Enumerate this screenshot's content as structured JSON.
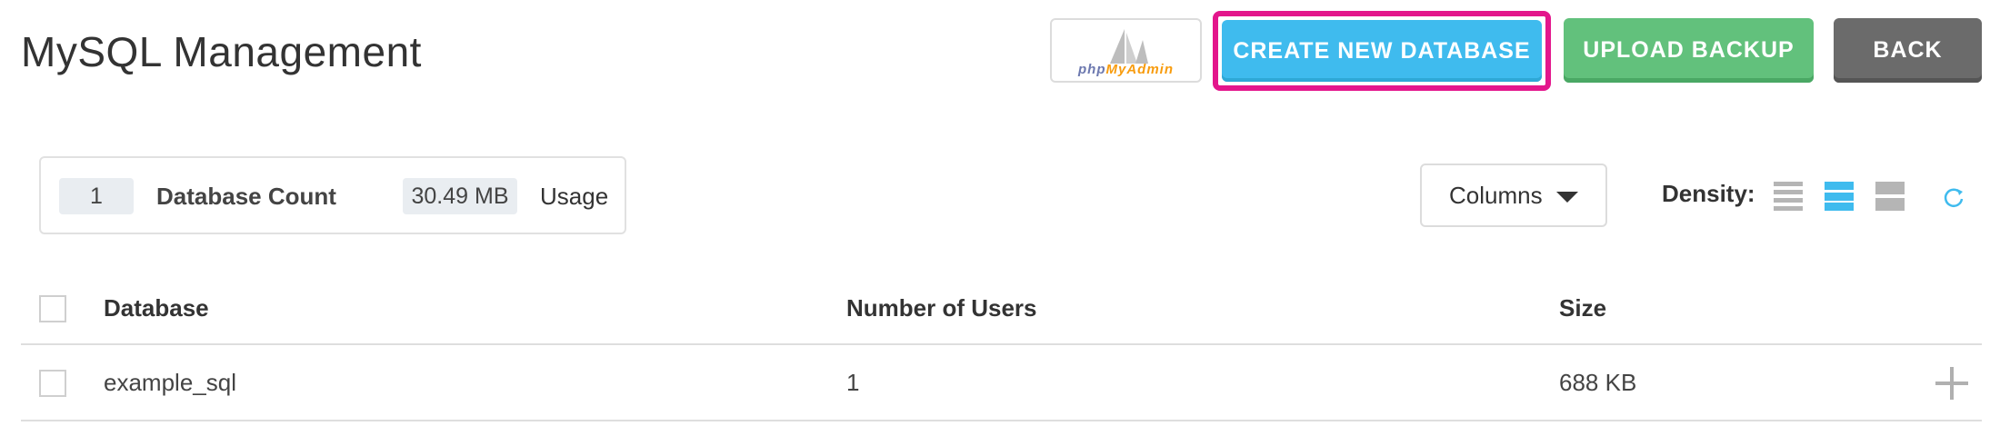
{
  "header": {
    "title": "MySQL Management",
    "phpmyadmin": {
      "php": "php",
      "myadmin": "MyAdmin"
    },
    "create_label": "CREATE NEW DATABASE",
    "upload_label": "UPLOAD BACKUP",
    "back_label": "BACK"
  },
  "stats": {
    "database_count": "1",
    "database_count_label": "Database Count",
    "usage_value": "30.49 MB",
    "usage_label": "Usage"
  },
  "controls": {
    "columns_label": "Columns",
    "density_label": "Density:",
    "density_selected": "normal"
  },
  "table": {
    "columns": [
      "Database",
      "Number of Users",
      "Size"
    ],
    "rows": [
      {
        "database": "example_sql",
        "users": "1",
        "size": "688 KB"
      }
    ]
  },
  "colors": {
    "create": "#3fbbee",
    "upload": "#62c17c",
    "back": "#6b6b6b",
    "highlight": "#e3168c"
  }
}
